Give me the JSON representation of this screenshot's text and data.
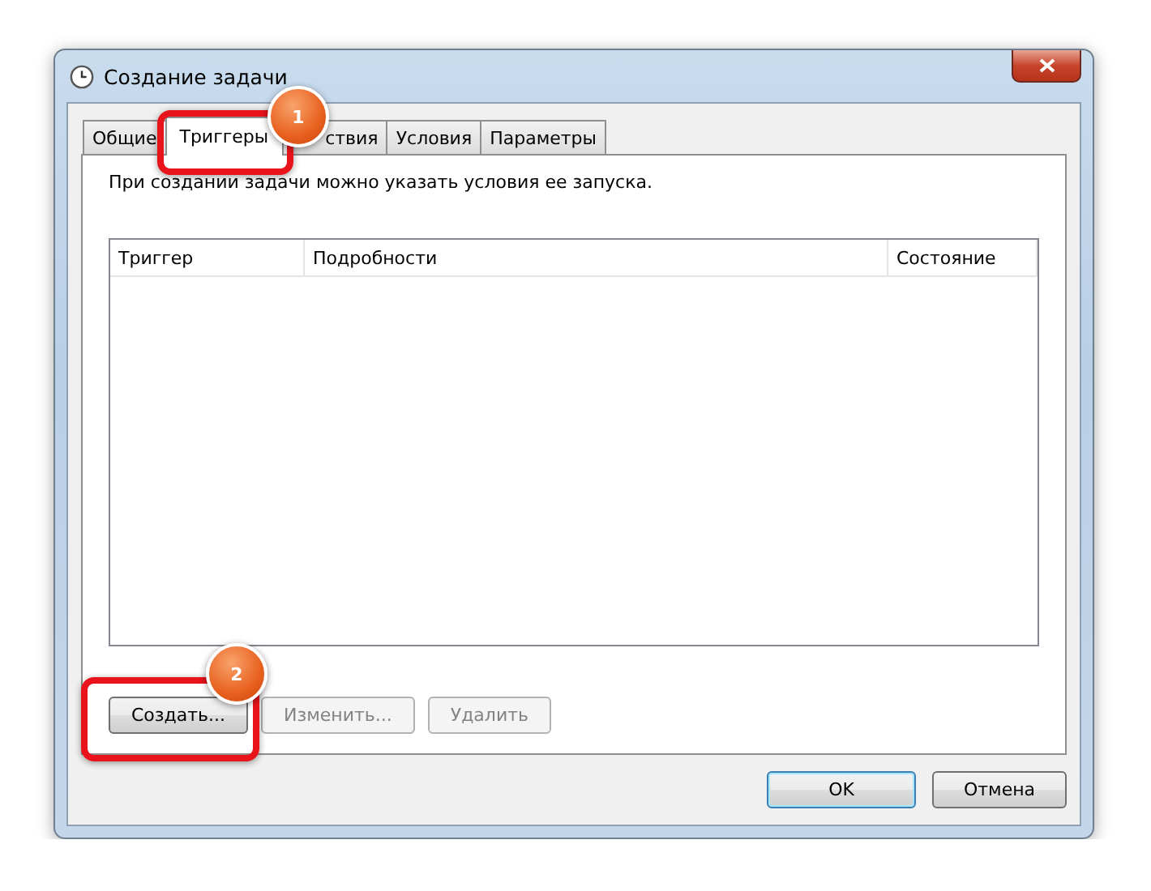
{
  "window": {
    "title": "Создание задачи"
  },
  "tabs": [
    {
      "label": "Общие",
      "selected": false
    },
    {
      "label": "Триггеры",
      "selected": true
    },
    {
      "label": "ствия",
      "selected": false
    },
    {
      "label": "Условия",
      "selected": false
    },
    {
      "label": "Параметры",
      "selected": false
    }
  ],
  "description": "При создании задачи можно указать условия ее запуска.",
  "table": {
    "columns": [
      "Триггер",
      "Подробности",
      "Состояние"
    ]
  },
  "list_buttons": [
    {
      "label": "Создать...",
      "disabled": false
    },
    {
      "label": "Изменить...",
      "disabled": true
    },
    {
      "label": "Удалить",
      "disabled": true
    }
  ],
  "dialog_buttons": [
    {
      "label": "OK",
      "default": true
    },
    {
      "label": "Отмена",
      "default": false
    }
  ],
  "callouts": [
    {
      "number": "1"
    },
    {
      "number": "2"
    }
  ]
}
